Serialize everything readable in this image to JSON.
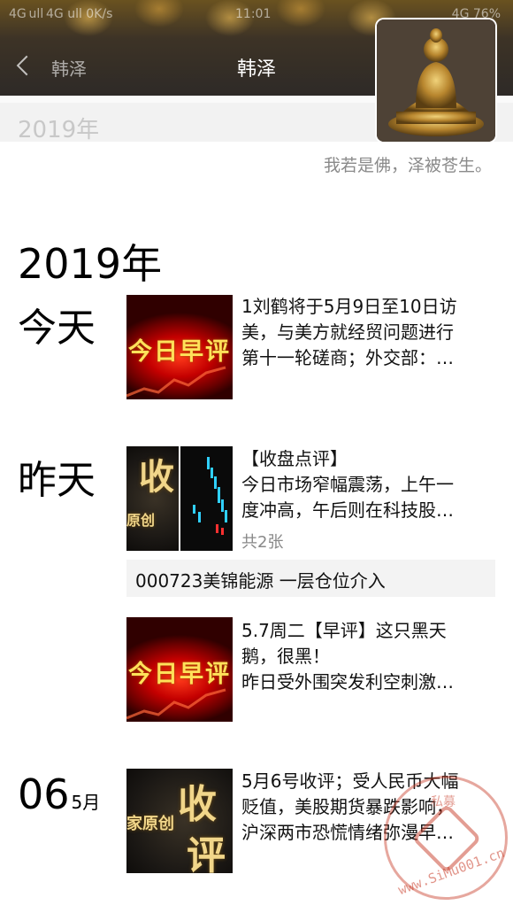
{
  "status_bar": {
    "left": "4G ull 4G ull  0K/s",
    "time": "11:01",
    "right": "4G 76%"
  },
  "nav": {
    "back_label": "韩泽",
    "title": "韩泽"
  },
  "header": {
    "sticky_year": "2019年",
    "signature": "我若是佛，泽被苍生。"
  },
  "timeline": {
    "year": "2019年",
    "groups": [
      {
        "day": "今天",
        "posts": [
          {
            "thumb_text": "今日早评",
            "lines": [
              "1刘鹤将于5月9日至10日访",
              "美，与美方就经贸问题进行",
              "第十一轮磋商；外交部：…"
            ]
          }
        ]
      },
      {
        "day": "昨天",
        "posts": [
          {
            "thumb_text_a": "收",
            "thumb_text_b": "原创",
            "lines": [
              "【收盘点评】",
              "今日市场窄幅震荡，上午一",
              "度冲高，午后则在科技股…"
            ],
            "count": "共2张"
          },
          {
            "text_only": "000723美锦能源 一层仓位介入"
          },
          {
            "thumb_text": "今日早评",
            "lines": [
              "5.7周二【早评】这只黑天",
              "鹅，很黑！",
              "昨日受外围突发利空刺激…"
            ]
          }
        ]
      },
      {
        "day": "06",
        "month": "5月",
        "posts": [
          {
            "thumb_text_a": "收",
            "thumb_text_b": "评",
            "thumb_text_c": "家原创",
            "lines": [
              "5月6号收评；受人民币大幅",
              "贬值，美股期货暴跌影响，",
              "沪深两市恐慌情绪弥漫早…"
            ]
          }
        ]
      }
    ]
  },
  "watermark": {
    "text": "www.SiMu001.cn",
    "chars": "私募"
  }
}
